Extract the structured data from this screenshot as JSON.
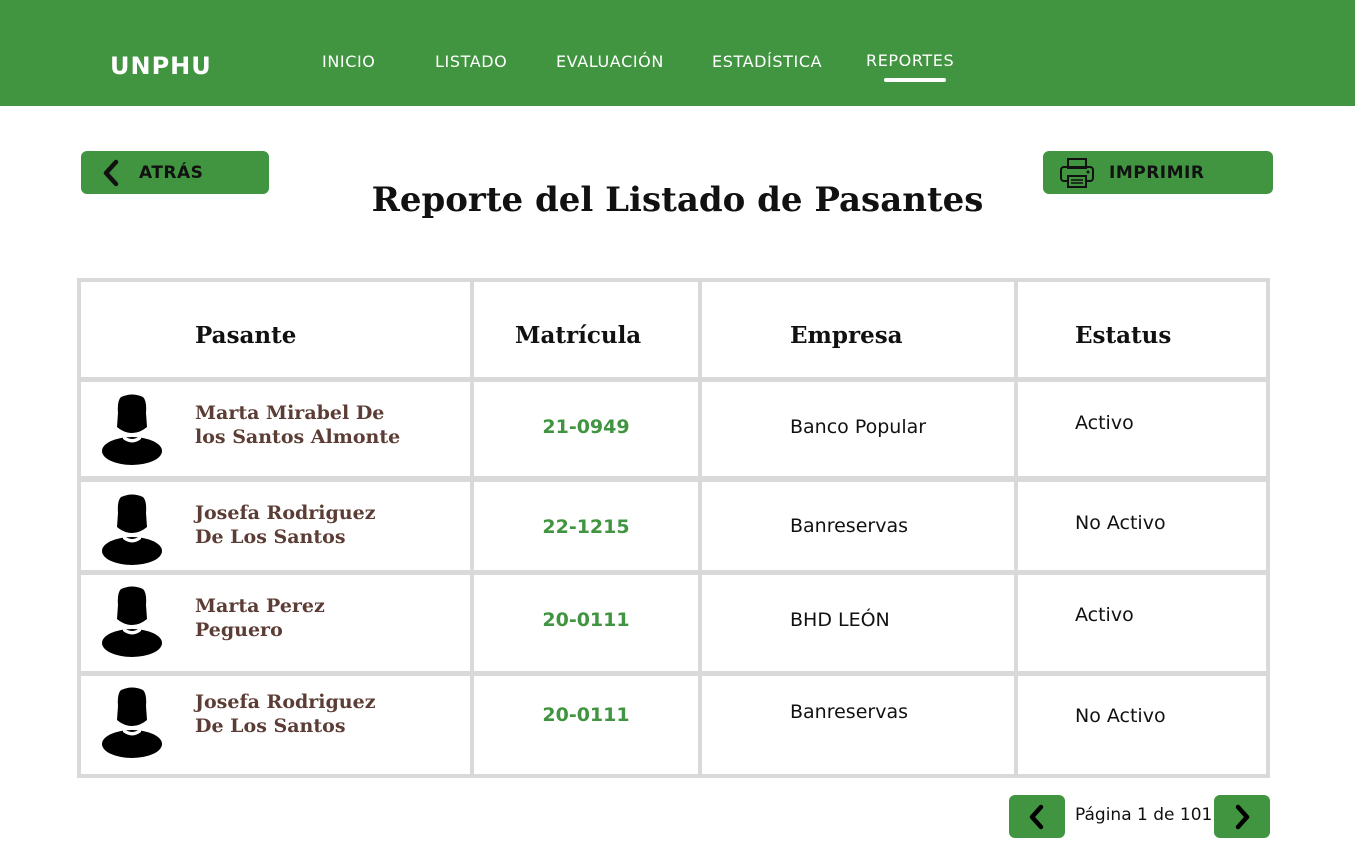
{
  "header": {
    "brand": "UNPHU",
    "nav": [
      "INICIO",
      "LISTADO",
      "EVALUACIÓN",
      "ESTADÍSTICA",
      "REPORTES"
    ],
    "active": "REPORTES"
  },
  "actions": {
    "back_label": "ATRÁS",
    "print_label": "IMPRIMIR"
  },
  "page_title": "Reporte del Listado de Pasantes",
  "table": {
    "columns": [
      "Pasante",
      "Matrícula",
      "Empresa",
      "Estatus"
    ],
    "rows": [
      {
        "name_line1": "Marta  Mirabel De",
        "name_line2": "los Santos Almonte",
        "matricula": "21-0949",
        "empresa": "Banco Popular",
        "estatus": "Activo"
      },
      {
        "name_line1": "Josefa Rodriguez",
        "name_line2": "De Los Santos",
        "matricula": "22-1215",
        "empresa": "Banreservas",
        "estatus": "No Activo"
      },
      {
        "name_line1": "Marta  Perez",
        "name_line2": "Peguero",
        "matricula": "20-0111",
        "empresa": "BHD LEÓN",
        "estatus": "Activo"
      },
      {
        "name_line1": "Josefa Rodriguez",
        "name_line2": "De Los Santos",
        "matricula": "20-0111",
        "empresa": "Banreservas",
        "estatus": "No Activo"
      }
    ]
  },
  "pagination": {
    "text": "Página 1 de 101"
  },
  "colors": {
    "brand_green": "#419541",
    "name_brown": "#5c3d35"
  },
  "icons": [
    "chevron-left-icon",
    "printer-icon",
    "user-avatar-icon",
    "chevron-right-icon"
  ]
}
